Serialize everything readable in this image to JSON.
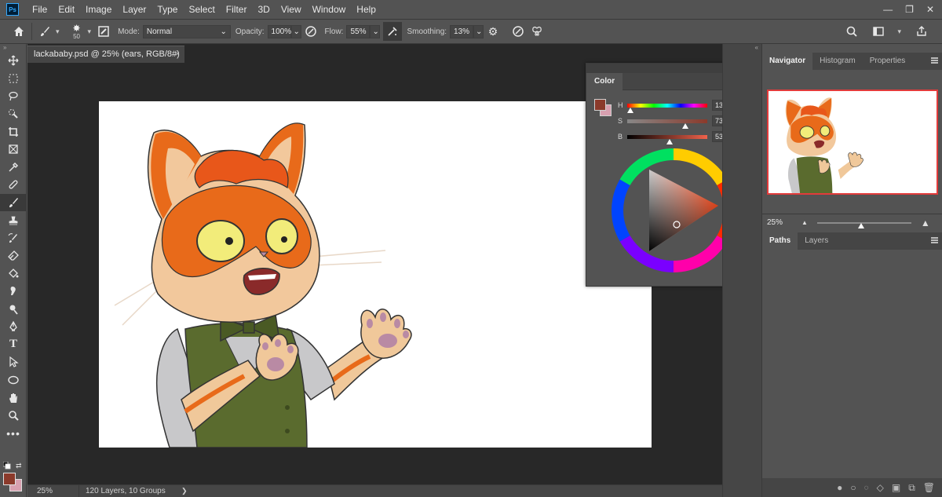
{
  "app": {
    "logo": "Ps",
    "menu": [
      "File",
      "Edit",
      "Image",
      "Layer",
      "Type",
      "Select",
      "Filter",
      "3D",
      "View",
      "Window",
      "Help"
    ],
    "window_controls": {
      "minimize": "—",
      "maximize": "❐",
      "close": "✕"
    }
  },
  "options": {
    "brush_size": "50",
    "mode_label": "Mode:",
    "mode_value": "Normal",
    "opacity_label": "Opacity:",
    "opacity_value": "100%",
    "flow_label": "Flow:",
    "flow_value": "55%",
    "smoothing_label": "Smoothing:",
    "smoothing_value": "13%"
  },
  "document": {
    "tab_title": "lackababy.psd @ 25% (ears, RGB/8#)",
    "tab_close": "×",
    "zoom": "25%",
    "info": "120 Layers, 10 Groups",
    "info_arrow": "❯"
  },
  "color_panel": {
    "title": "Color",
    "collapse_glyphs": "◂◂  ✕",
    "h_label": "H",
    "h_value": "13",
    "h_unit": "°",
    "s_label": "S",
    "s_value": "73",
    "s_unit": "%",
    "b_label": "B",
    "b_value": "53",
    "b_unit": "%",
    "foreground": "#8b3a2b",
    "background": "#d8a0b0"
  },
  "navigator_panel": {
    "tabs": [
      "Navigator",
      "Histogram",
      "Properties"
    ],
    "zoom": "25%"
  },
  "layers_panel": {
    "tabs": [
      "Paths",
      "Layers"
    ]
  },
  "colors": {
    "accent_border": "#e23b3b",
    "panel": "#535353",
    "canvas_bg": "#282828"
  }
}
